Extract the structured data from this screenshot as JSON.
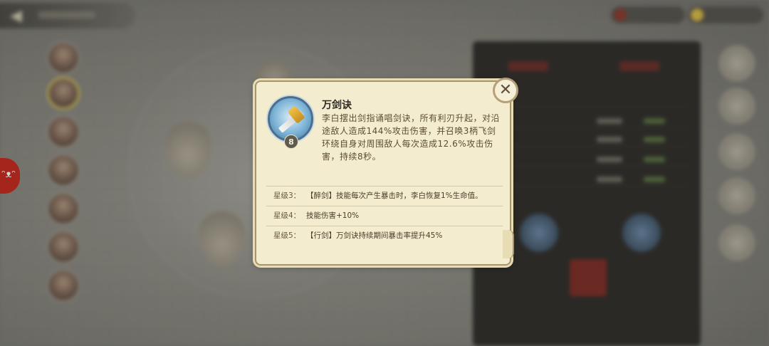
{
  "tooltip": {
    "skill_name": "万剑诀",
    "skill_level": "8",
    "description": "李白摆出剑指诵唱剑诀，所有利刃升起，对沿途敌人造成144%攻击伤害，并召唤3柄飞剑环绕自身对周围敌人每次造成12.6%攻击伤害，持续8秒。",
    "close_symbol": "✕",
    "star_levels": [
      {
        "label": "星级3：",
        "text": "【醉剑】技能每次产生暴击时，李白恢复1%生命值。"
      },
      {
        "label": "星级4：",
        "text": "技能伤害+10%"
      },
      {
        "label": "星级5：",
        "text": "【行剑】万剑诀持续期间暴击率提升45%"
      }
    ]
  },
  "icons": {
    "back": "back-arrow-icon",
    "skill": "sword-skill-icon",
    "close": "close-icon"
  },
  "colors": {
    "card_bg": "#f3eccf",
    "card_border": "#a8946a",
    "text_dark": "#2f2a22",
    "text_body": "#5b4c35",
    "skill_blue": "#4a6f8e"
  }
}
